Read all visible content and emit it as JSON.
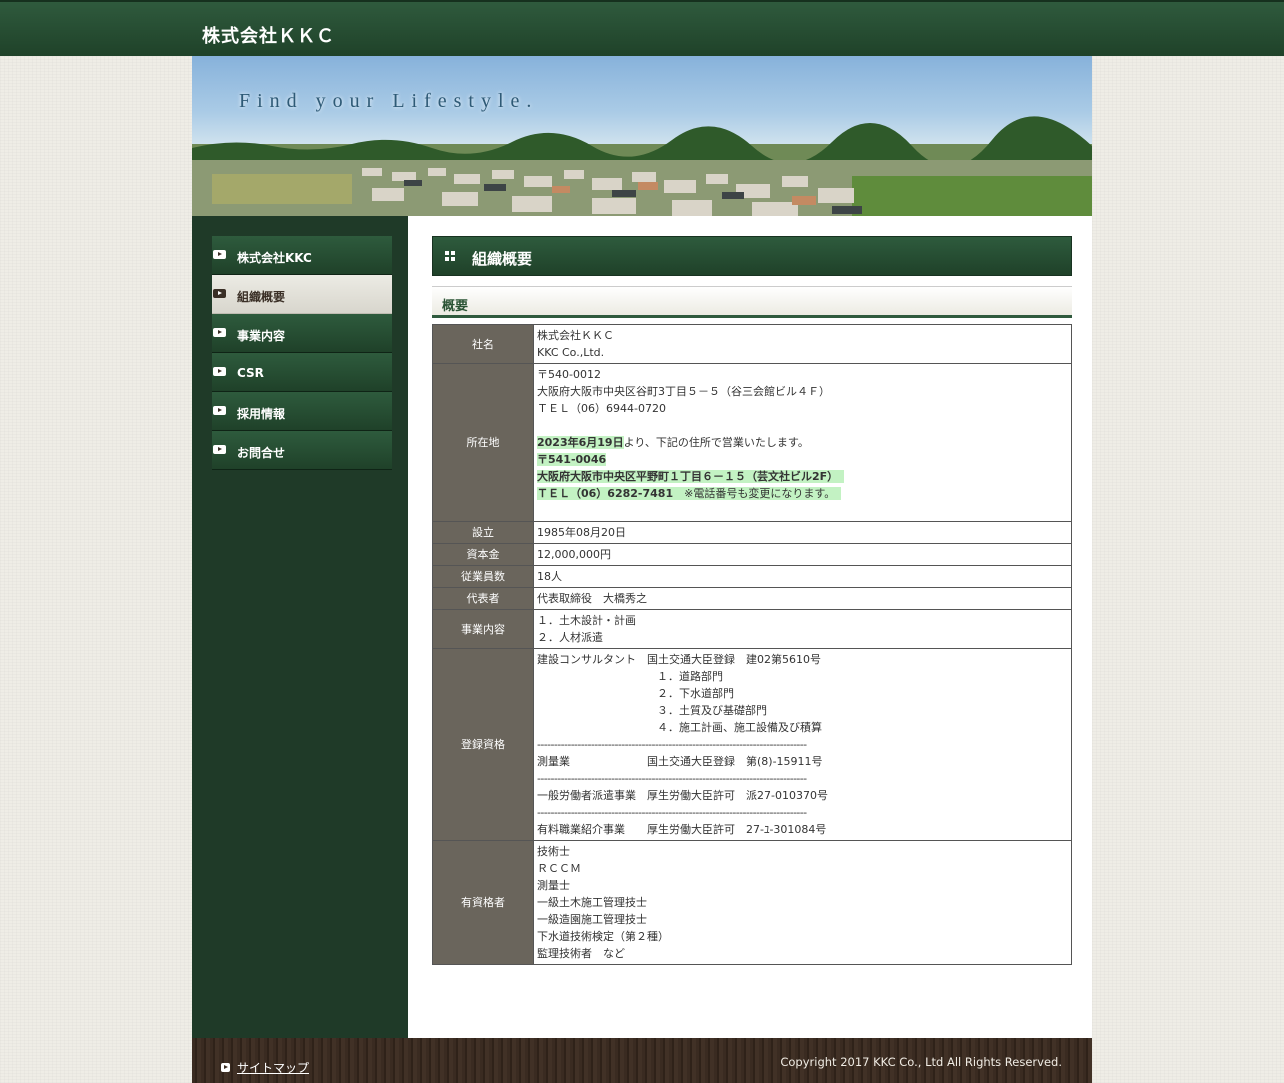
{
  "header": {
    "site_title": "株式会社ＫＫＣ"
  },
  "hero": {
    "tagline": "Find your Lifestyle."
  },
  "sidebar": {
    "items": [
      {
        "label": "株式会社KKC",
        "active": false
      },
      {
        "label": "組織概要",
        "active": true
      },
      {
        "label": "事業内容",
        "active": false
      },
      {
        "label": "CSR",
        "active": false
      },
      {
        "label": "採用情報",
        "active": false
      },
      {
        "label": "お問合せ",
        "active": false
      }
    ]
  },
  "main": {
    "page_title": "組織概要",
    "section_title": "概要",
    "table": {
      "company": {
        "label": "社名",
        "lines": [
          "株式会社ＫＫＣ",
          "KKC Co.,Ltd."
        ]
      },
      "address": {
        "label": "所在地",
        "lines": [
          "〒540-0012",
          "大阪府大阪市中央区谷町3丁目５－５（谷三会館ビル４Ｆ）",
          "ＴＥＬ（06）6944-0720"
        ],
        "notice_date": "2023年6月19日",
        "notice_text": "より、下記の住所で営業いたします。",
        "new_postal": "〒541-0046",
        "new_address": "大阪府大阪市中央区平野町１丁目６－１５（芸文社ビル2F）",
        "new_tel": "ＴＥＬ（06）6282-7481",
        "new_tel_note": "　※電話番号も変更になります。"
      },
      "founded": {
        "label": "設立",
        "value": "1985年08月20日"
      },
      "capital": {
        "label": "資本金",
        "value": "12,000,000円"
      },
      "employees": {
        "label": "従業員数",
        "value": "18人"
      },
      "representative": {
        "label": "代表者",
        "value": "代表取締役　大橋秀之"
      },
      "business": {
        "label": "事業内容",
        "lines": [
          "１．土木設計・計画",
          "２．人材派遣"
        ]
      },
      "registration": {
        "label": "登録資格",
        "consultant": "建設コンサルタント　国土交通大臣登録　建02第5610号",
        "departments": [
          "１．道路部門",
          "２．下水道部門",
          "３．土質及び基礎部門",
          "４．施工計画、施工設備及び積算"
        ],
        "separator": "--------------------------------------------------------------------------------",
        "survey": "測量業　　　　　　　国土交通大臣登録　第(8)-15911号",
        "dispatch": "一般労働者派遣事業　厚生労働大臣許可　派27-010370号",
        "placement": "有料職業紹介事業　　厚生労働大臣許可　27-ﾕ-301084号"
      },
      "qualified": {
        "label": "有資格者",
        "lines": [
          "技術士",
          "ＲＣＣＭ",
          "測量士",
          "一級土木施工管理技士",
          "一級造園施工管理技士",
          "下水道技術検定（第２種）",
          "監理技術者　など"
        ]
      }
    }
  },
  "footer": {
    "sitemap_label": "サイトマップ",
    "copyright": "Copyright 2017 KKC Co., Ltd All Rights Reserved."
  },
  "colors": {
    "brand_green": "#1f4229",
    "header_label_bg": "#6a655c",
    "highlight": "#c3f2c3",
    "footer_wood": "#3a2b21"
  }
}
